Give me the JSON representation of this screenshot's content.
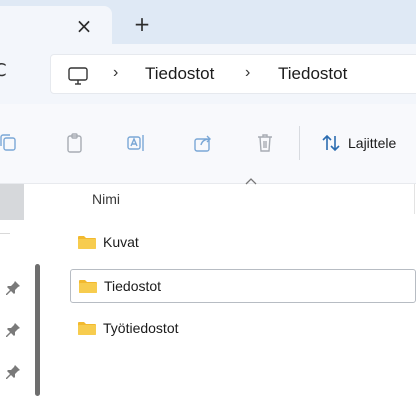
{
  "tabbar": {
    "close_glyph": "×",
    "new_tab_glyph": "+"
  },
  "addressbar": {
    "refresh_glyph": "C",
    "root_icon": "monitor-icon",
    "separator": "›",
    "crumbs": [
      "Tiedostot",
      "Tiedostot"
    ]
  },
  "toolbar": {
    "icons": [
      "copy-icon",
      "paste-icon",
      "rename-icon",
      "share-icon",
      "delete-icon"
    ],
    "sort_label": "Lajittele",
    "accent_color": "#2b6cb0"
  },
  "navpane": {
    "pins": [
      "pin-icon",
      "pin-icon",
      "pin-icon"
    ]
  },
  "content": {
    "column_header": "Nimi",
    "sort_caret": "^",
    "folder_color": "#f5c542",
    "items": [
      {
        "label": "Kuvat",
        "selected": false
      },
      {
        "label": "Tiedostot",
        "selected": true
      },
      {
        "label": "Työtiedostot",
        "selected": false
      }
    ]
  }
}
